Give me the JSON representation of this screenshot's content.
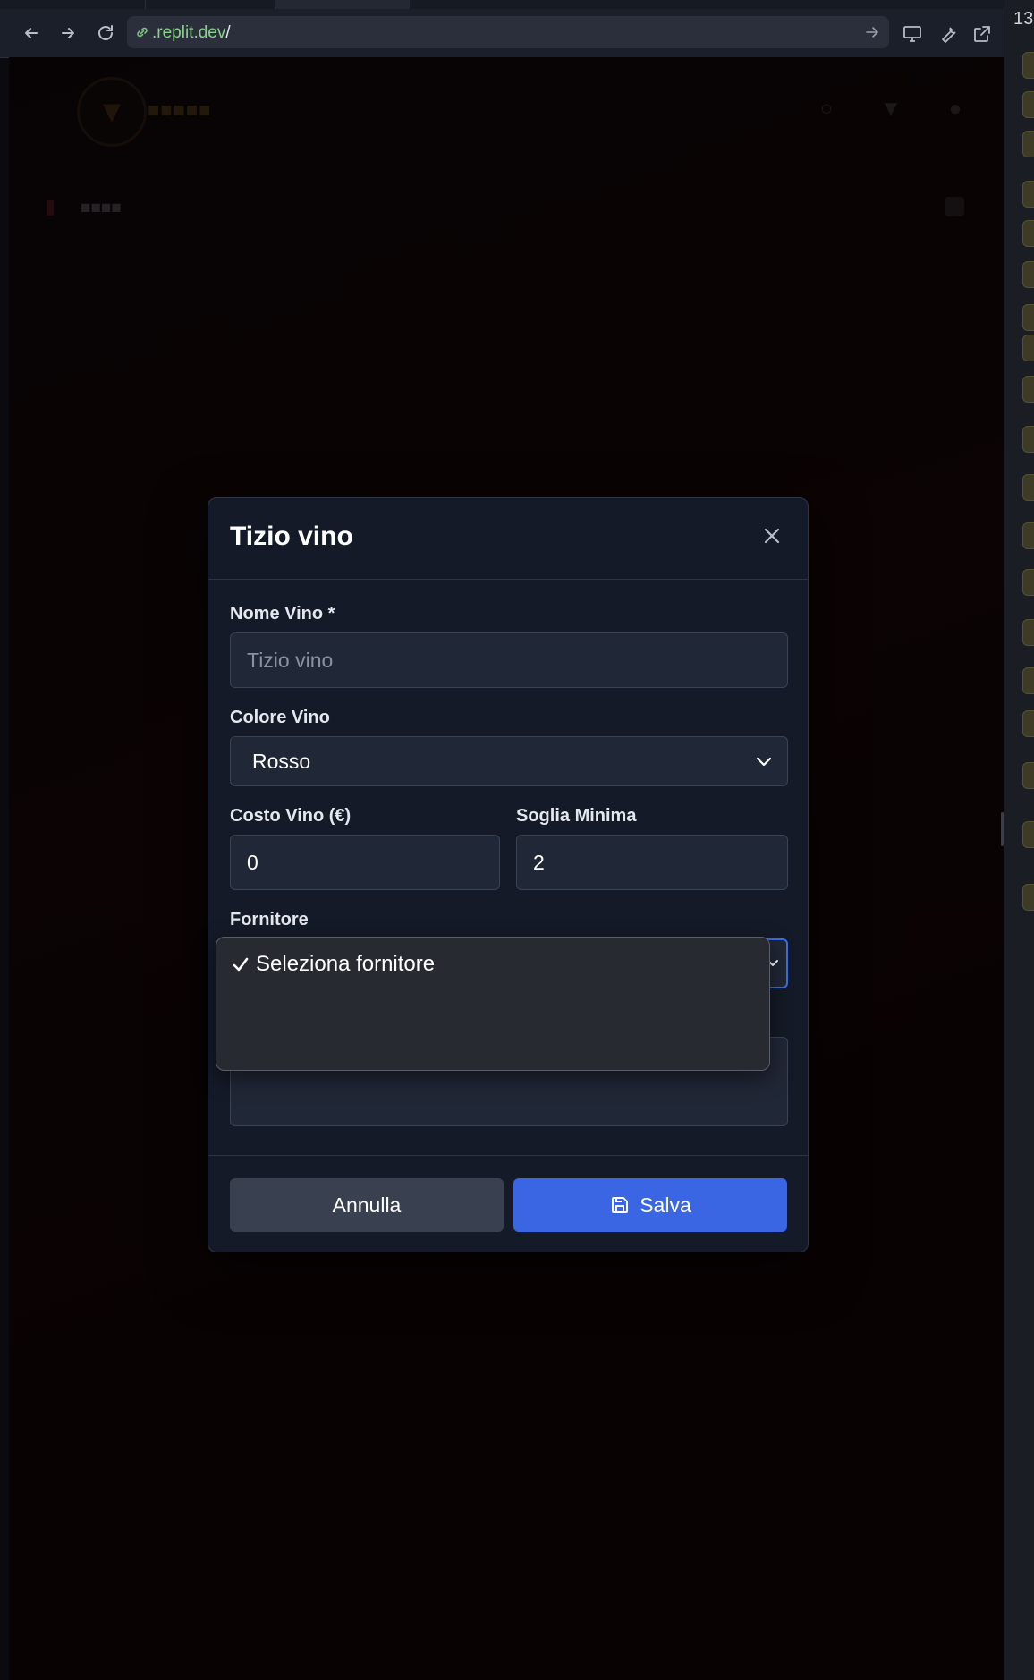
{
  "browser": {
    "url_domain": ".replit.dev",
    "url_path": "/"
  },
  "sidebar_strip": {
    "number": "13"
  },
  "modal": {
    "title": "Tizio vino",
    "fields": {
      "nome_vino": {
        "label": "Nome Vino *",
        "placeholder": "Tizio vino"
      },
      "colore_vino": {
        "label": "Colore Vino",
        "value": "Rosso"
      },
      "costo_vino": {
        "label": "Costo Vino (€)",
        "value": "0"
      },
      "soglia_minima": {
        "label": "Soglia Minima",
        "value": "2"
      },
      "fornitore": {
        "label": "Fornitore"
      }
    },
    "buttons": {
      "cancel": "Annulla",
      "save": "Salva"
    }
  },
  "dropdown": {
    "options": [
      {
        "label": "Seleziona fornitore",
        "selected": true
      }
    ]
  },
  "colors": {
    "primary_button": "#3a66e4",
    "modal_bg": "#141a27",
    "focus_border": "#3b6fe0"
  }
}
